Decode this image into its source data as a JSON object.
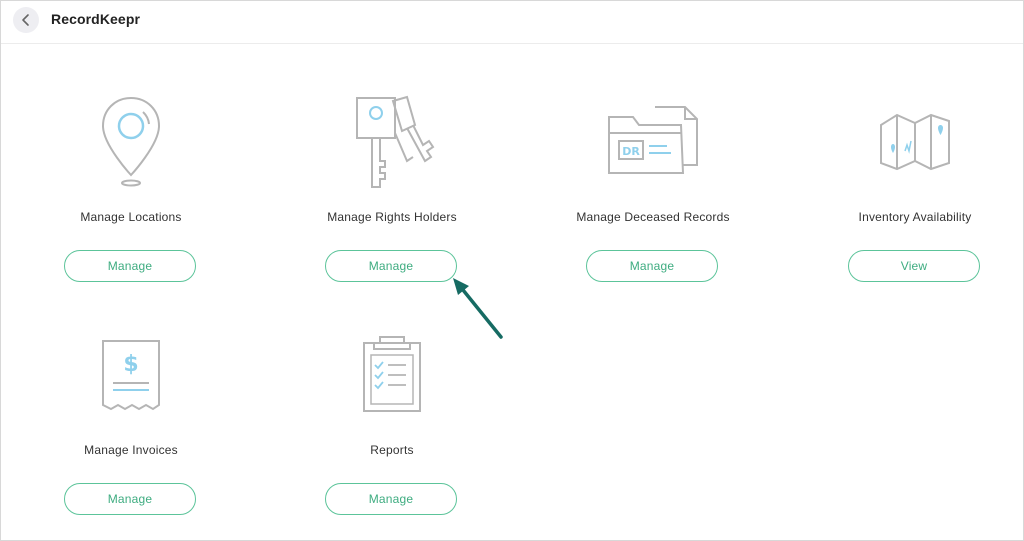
{
  "app": {
    "title": "RecordKeepr"
  },
  "header": {
    "back_icon": "chevron-left-icon"
  },
  "cards": [
    {
      "label": "Manage Locations",
      "button": "Manage",
      "icon": "map-pin-icon"
    },
    {
      "label": "Manage Rights Holders",
      "button": "Manage",
      "icon": "keys-icon"
    },
    {
      "label": "Manage Deceased Records",
      "button": "Manage",
      "icon": "dr-folder-icon"
    },
    {
      "label": "Inventory Availability",
      "button": "View",
      "icon": "folded-map-icon"
    },
    {
      "label": "Manage Invoices",
      "button": "Manage",
      "icon": "invoice-receipt-icon"
    },
    {
      "label": "Reports",
      "button": "Manage",
      "icon": "clipboard-checklist-icon"
    }
  ],
  "colors": {
    "accent": "#5cc49a",
    "accent_text": "#3eac80",
    "icon_gray": "#b5b5b5",
    "icon_blue": "#8fd0ec",
    "annotation_arrow": "#166b63"
  }
}
